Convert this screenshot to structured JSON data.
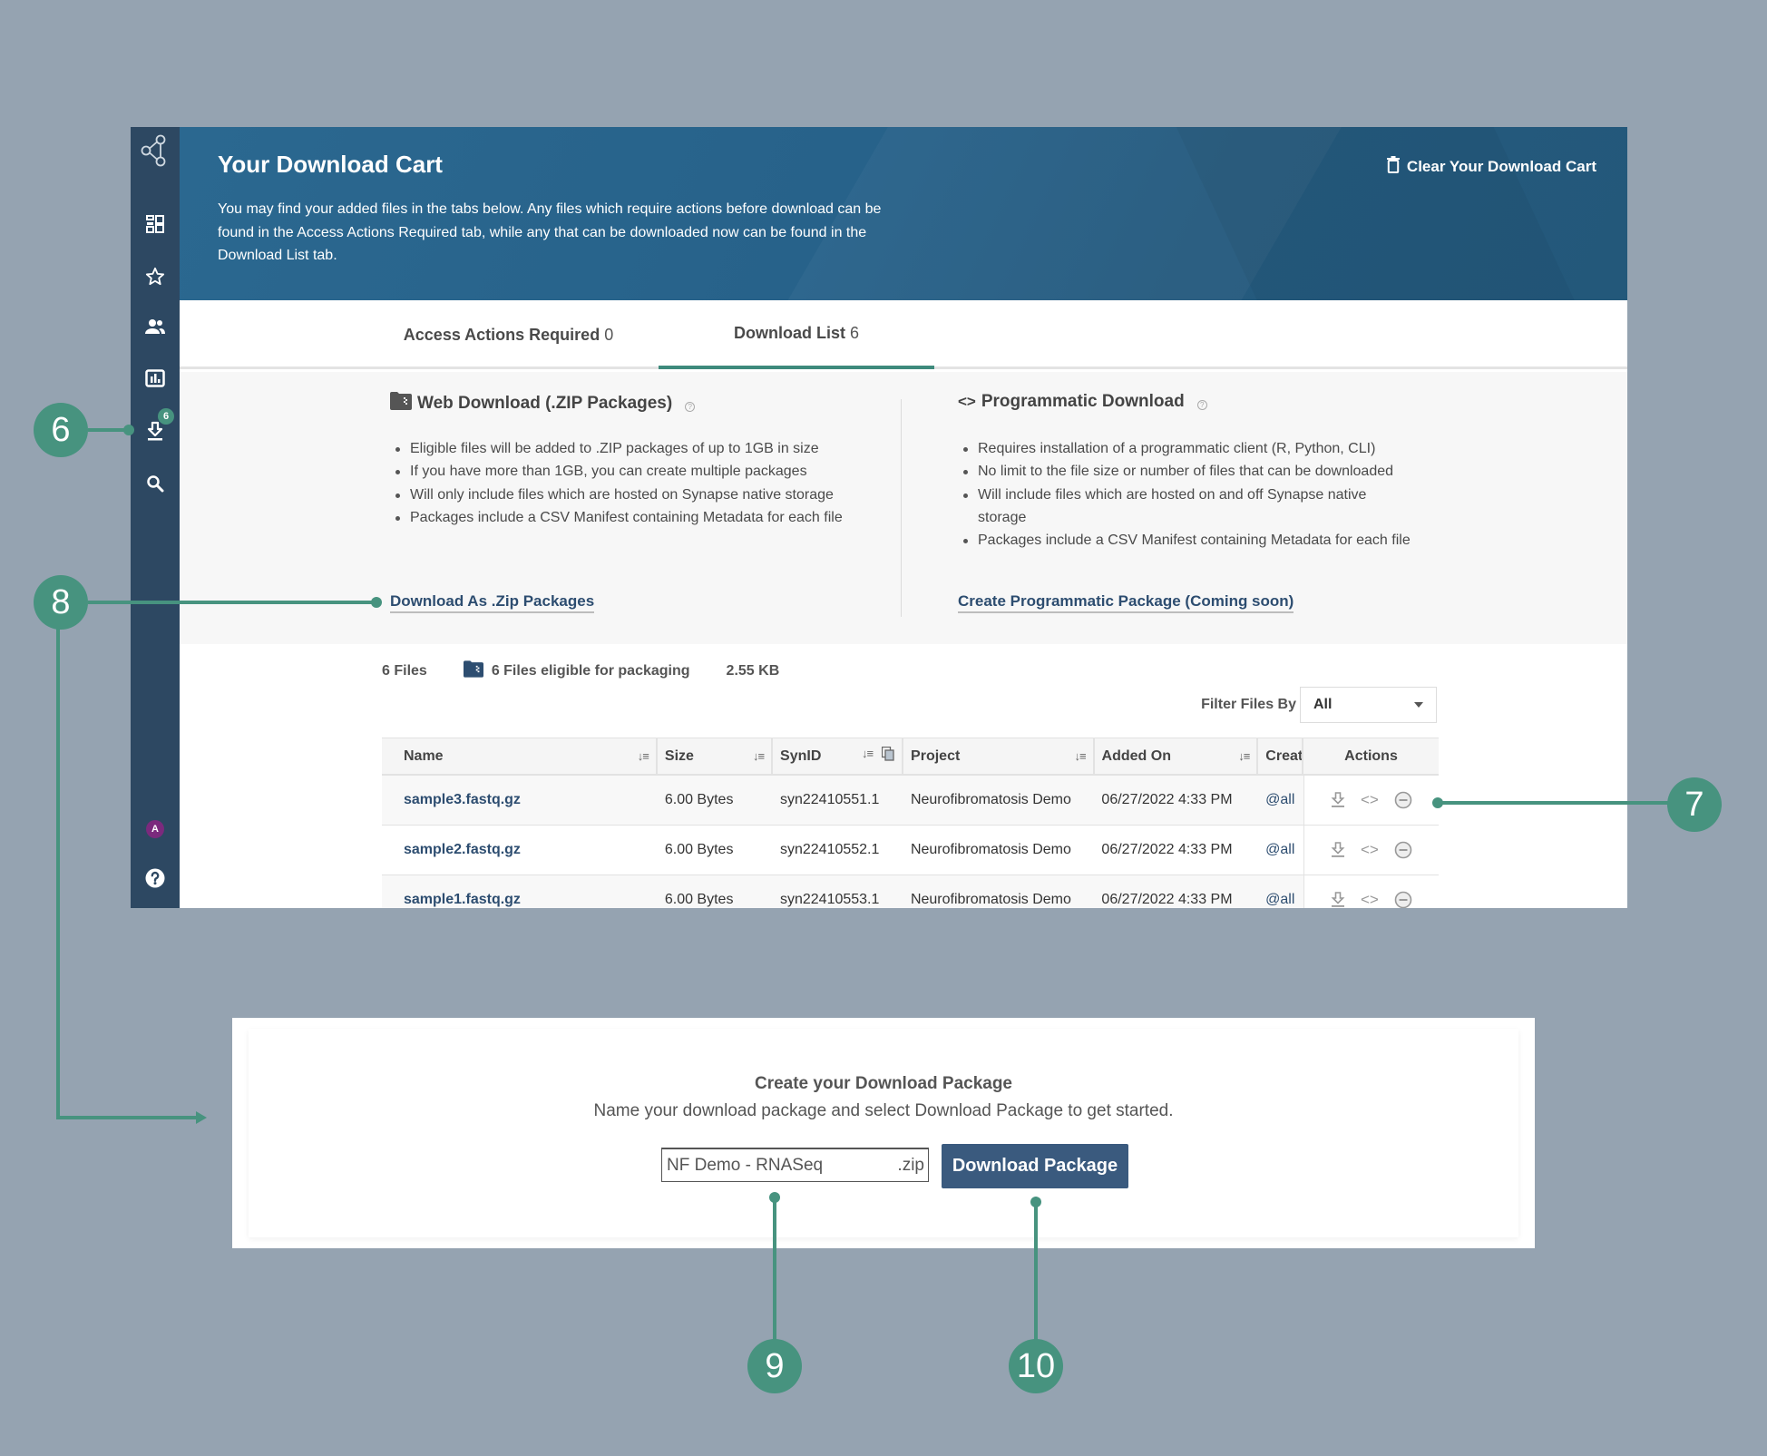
{
  "sidebar": {
    "items": [
      {
        "name": "logo",
        "icon": "synapse-logo-icon"
      },
      {
        "name": "projects",
        "icon": "dashboard-icon"
      },
      {
        "name": "favorites",
        "icon": "star-icon"
      },
      {
        "name": "teams",
        "icon": "people-icon"
      },
      {
        "name": "challenges",
        "icon": "chart-icon"
      },
      {
        "name": "downloads",
        "icon": "download-icon",
        "badge": "6"
      },
      {
        "name": "search",
        "icon": "search-icon"
      }
    ],
    "avatar_initial": "A",
    "help_icon": "question-circle-icon"
  },
  "banner": {
    "title": "Your Download Cart",
    "description": "You may find your added files in the tabs below. Any files which require actions before download can be found in the Access Actions Required tab, while any that can be downloaded now can be found in the Download List tab.",
    "clear_button": "Clear Your Download Cart"
  },
  "tabs": [
    {
      "label": "Access Actions Required",
      "count": "0",
      "active": false
    },
    {
      "label": "Download List",
      "count": "6",
      "active": true
    }
  ],
  "web_download": {
    "title": "Web Download (.ZIP Packages)",
    "bullets": [
      "Eligible files will be added to .ZIP packages of up to 1GB in size",
      "If you have more than 1GB, you can create multiple packages",
      "Will only include files which are hosted on Synapse native storage",
      "Packages include a CSV Manifest containing Metadata for each file"
    ],
    "link": "Download As .Zip Packages"
  },
  "programmatic_download": {
    "title": "Programmatic Download",
    "bullets": [
      "Requires installation of a programmatic client (R, Python, CLI)",
      "No limit to the file size or number of files that can be downloaded",
      "Will include files which are hosted on and off Synapse native storage",
      "Packages include a CSV Manifest containing Metadata for each file"
    ],
    "link": "Create Programmatic Package (Coming soon)"
  },
  "stats": {
    "file_count": "6 Files",
    "eligible": "6 Files eligible for packaging",
    "total_size": "2.55 KB"
  },
  "filter": {
    "label": "Filter Files By",
    "selected": "All"
  },
  "table": {
    "headers": [
      "Name",
      "Size",
      "SynID",
      "Project",
      "Added On",
      "Creat",
      "Actions"
    ],
    "rows": [
      {
        "name": "sample3.fastq.gz",
        "size": "6.00 Bytes",
        "synid": "syn22410551.1",
        "project": "Neurofibromatosis Demo",
        "added": "06/27/2022 4:33 PM",
        "created_by": "@all"
      },
      {
        "name": "sample2.fastq.gz",
        "size": "6.00 Bytes",
        "synid": "syn22410552.1",
        "project": "Neurofibromatosis Demo",
        "added": "06/27/2022 4:33 PM",
        "created_by": "@all"
      },
      {
        "name": "sample1.fastq.gz",
        "size": "6.00 Bytes",
        "synid": "syn22410553.1",
        "project": "Neurofibromatosis Demo",
        "added": "06/27/2022 4:33 PM",
        "created_by": "@all"
      }
    ]
  },
  "package": {
    "title": "Create your Download Package",
    "subtitle": "Name your download package and select Download Package to get started.",
    "input_value": "NF Demo - RNASeq",
    "extension": ".zip",
    "button": "Download Package"
  },
  "callouts": [
    "6",
    "7",
    "8",
    "9",
    "10"
  ],
  "colors": {
    "accent": "#47937f",
    "sidebar": "#2d4862",
    "banner": "#27628a",
    "link": "#2d4d70",
    "button": "#3a5a7e",
    "background": "#95a3b1"
  }
}
